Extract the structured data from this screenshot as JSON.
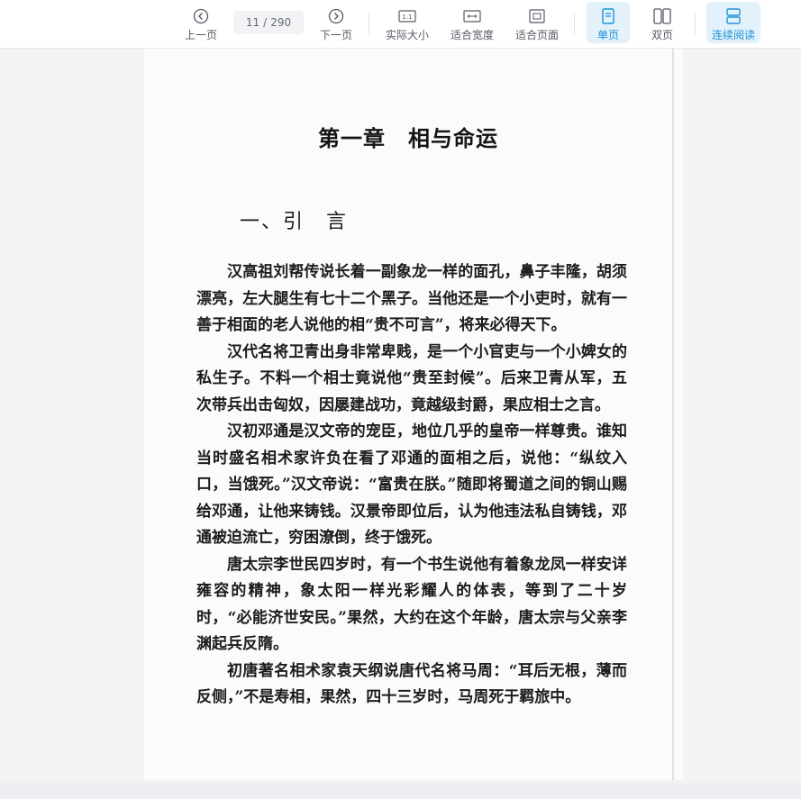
{
  "toolbar": {
    "prev_label": "上一页",
    "next_label": "下一页",
    "page_current": "11",
    "page_sep": "/",
    "page_total": "290",
    "actual_size_label": "实际大小",
    "fit_width_label": "适合宽度",
    "fit_page_label": "适合页面",
    "single_page_label": "单页",
    "double_page_label": "双页",
    "continuous_label": "连续阅读",
    "accent_color": "#1a93d8"
  },
  "document": {
    "chapter_title": "第一章　相与命运",
    "section_title": "一、引　言",
    "paragraphs": [
      "汉高祖刘帮传说长着一副象龙一样的面孔，鼻子丰隆，胡须漂亮，左大腿生有七十二个黑子。当他还是一个小吏时，就有一善于相面的老人说他的相“贵不可言”，将来必得天下。",
      "汉代名将卫青出身非常卑贱，是一个小官吏与一个小婢女的私生子。不料一个相士竟说他“贵至封候”。后来卫青从军，五次带兵出击匈奴，因屡建战功，竟越级封爵，果应相士之言。",
      "汉初邓通是汉文帝的宠臣，地位几乎的皇帝一样尊贵。谁知当时盛名相术家许负在看了邓通的面相之后，说他：“纵纹入口，当饿死。”汉文帝说：“富贵在朕。”随即将蜀道之间的铜山赐给邓通，让他来铸钱。汉景帝即位后，认为他违法私自铸钱，邓通被迫流亡，穷困潦倒，终于饿死。",
      "唐太宗李世民四岁时，有一个书生说他有着象龙凤一样安详雍容的精神，象太阳一样光彩耀人的体表，等到了二十岁时，“必能济世安民。”果然，大约在这个年龄，唐太宗与父亲李渊起兵反隋。",
      "初唐著名相术家袁天纲说唐代名将马周：“耳后无根，薄而反侧，”不是寿相，果然，四十三岁时，马周死于羁旅中。"
    ]
  }
}
